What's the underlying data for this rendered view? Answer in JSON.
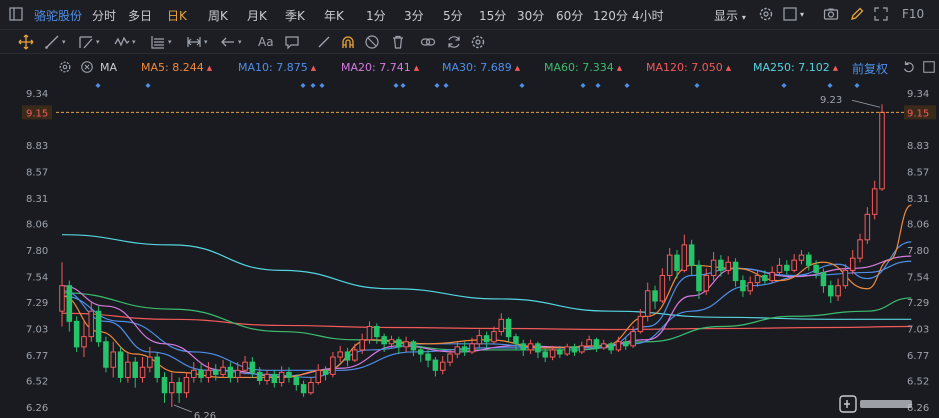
{
  "toolbar": {
    "stock_name": "骆驼股份",
    "periods": [
      "分时",
      "多日",
      "日K",
      "周K",
      "月K",
      "季K",
      "年K",
      "1分",
      "3分",
      "5分",
      "15分",
      "30分",
      "60分",
      "120分",
      "4小时"
    ],
    "active_period": "日K",
    "display_label": "显示",
    "f10_label": "F10"
  },
  "drawbar": {
    "text_tool_label": "Aa"
  },
  "ma_legend": {
    "type_label": "MA",
    "items": [
      {
        "label": "MA5: 8.244",
        "color": "#f08a3c"
      },
      {
        "label": "MA10: 7.875",
        "color": "#4f8fe8"
      },
      {
        "label": "MA20: 7.741",
        "color": "#d67be0"
      },
      {
        "label": "MA30: 7.689",
        "color": "#4f8fe8"
      },
      {
        "label": "MA60: 7.334",
        "color": "#3dbb6e"
      },
      {
        "label": "MA120: 7.050",
        "color": "#f25a5a"
      },
      {
        "label": "MA250: 7.102",
        "color": "#55d4e0"
      }
    ],
    "adjust_label": "前复权",
    "up_color": "#f25a5a"
  },
  "chart_data": {
    "type": "candlestick",
    "y_ticks": [
      "9.34",
      "9.15",
      "8.83",
      "8.57",
      "8.31",
      "8.06",
      "7.80",
      "7.54",
      "7.29",
      "7.03",
      "6.77",
      "6.52",
      "6.26"
    ],
    "ylim": [
      6.2,
      9.4
    ],
    "current_price": "9.15",
    "high_annotation": "9.23",
    "low_annotation": "6.26",
    "up_color": "#f25a5a",
    "down_color": "#27c36a",
    "candles": [
      [
        7.2,
        7.45,
        7.68,
        7.05
      ],
      [
        7.45,
        7.1,
        7.5,
        7.0
      ],
      [
        7.1,
        6.85,
        7.15,
        6.8
      ],
      [
        6.85,
        6.95,
        7.1,
        6.75
      ],
      [
        6.95,
        7.2,
        7.3,
        6.9
      ],
      [
        7.2,
        6.9,
        7.25,
        6.85
      ],
      [
        6.9,
        6.65,
        6.95,
        6.6
      ],
      [
        6.65,
        6.8,
        6.9,
        6.55
      ],
      [
        6.8,
        6.55,
        6.85,
        6.5
      ],
      [
        6.55,
        6.7,
        6.8,
        6.5
      ],
      [
        6.7,
        6.55,
        6.75,
        6.45
      ],
      [
        6.55,
        6.65,
        6.75,
        6.5
      ],
      [
        6.65,
        6.75,
        6.85,
        6.6
      ],
      [
        6.75,
        6.55,
        6.8,
        6.5
      ],
      [
        6.55,
        6.4,
        6.6,
        6.3
      ],
      [
        6.4,
        6.5,
        6.6,
        6.26
      ],
      [
        6.5,
        6.4,
        6.55,
        6.3
      ],
      [
        6.4,
        6.55,
        6.6,
        6.35
      ],
      [
        6.55,
        6.62,
        6.7,
        6.5
      ],
      [
        6.62,
        6.55,
        6.68,
        6.5
      ],
      [
        6.55,
        6.62,
        6.7,
        6.5
      ],
      [
        6.62,
        6.58,
        6.68,
        6.52
      ],
      [
        6.58,
        6.65,
        6.72,
        6.55
      ],
      [
        6.65,
        6.55,
        6.7,
        6.5
      ],
      [
        6.55,
        6.62,
        6.7,
        6.5
      ],
      [
        6.62,
        6.7,
        6.76,
        6.58
      ],
      [
        6.7,
        6.6,
        6.75,
        6.55
      ],
      [
        6.6,
        6.52,
        6.65,
        6.48
      ],
      [
        6.52,
        6.58,
        6.62,
        6.48
      ],
      [
        6.58,
        6.5,
        6.62,
        6.45
      ],
      [
        6.5,
        6.6,
        6.66,
        6.46
      ],
      [
        6.6,
        6.55,
        6.65,
        6.5
      ],
      [
        6.55,
        6.48,
        6.58,
        6.42
      ],
      [
        6.48,
        6.4,
        6.52,
        6.36
      ],
      [
        6.4,
        6.5,
        6.55,
        6.38
      ],
      [
        6.5,
        6.62,
        6.68,
        6.48
      ],
      [
        6.62,
        6.58,
        6.66,
        6.52
      ],
      [
        6.58,
        6.75,
        6.8,
        6.55
      ],
      [
        6.75,
        6.8,
        6.86,
        6.7
      ],
      [
        6.8,
        6.72,
        6.84,
        6.66
      ],
      [
        6.72,
        6.82,
        6.88,
        6.7
      ],
      [
        6.82,
        6.92,
        6.98,
        6.78
      ],
      [
        6.92,
        7.05,
        7.1,
        6.88
      ],
      [
        7.05,
        6.95,
        7.08,
        6.88
      ],
      [
        6.95,
        6.88,
        6.98,
        6.8
      ],
      [
        6.88,
        6.92,
        6.96,
        6.84
      ],
      [
        6.92,
        6.85,
        6.95,
        6.78
      ],
      [
        6.85,
        6.9,
        6.95,
        6.8
      ],
      [
        6.9,
        6.82,
        6.92,
        6.76
      ],
      [
        6.82,
        6.78,
        6.86,
        6.7
      ],
      [
        6.78,
        6.72,
        6.82,
        6.65
      ],
      [
        6.72,
        6.62,
        6.75,
        6.56
      ],
      [
        6.62,
        6.7,
        6.76,
        6.58
      ],
      [
        6.7,
        6.78,
        6.82,
        6.66
      ],
      [
        6.78,
        6.85,
        6.9,
        6.74
      ],
      [
        6.85,
        6.8,
        6.9,
        6.76
      ],
      [
        6.8,
        6.88,
        6.94,
        6.78
      ],
      [
        6.88,
        6.96,
        7.02,
        6.84
      ],
      [
        6.96,
        6.9,
        7.0,
        6.84
      ],
      [
        6.9,
        7.0,
        7.05,
        6.88
      ],
      [
        7.0,
        7.12,
        7.18,
        6.96
      ],
      [
        7.12,
        6.95,
        7.14,
        6.9
      ],
      [
        6.95,
        6.88,
        6.98,
        6.82
      ],
      [
        6.88,
        6.82,
        6.92,
        6.76
      ],
      [
        6.82,
        6.88,
        6.92,
        6.78
      ],
      [
        6.88,
        6.8,
        6.9,
        6.74
      ],
      [
        6.8,
        6.75,
        6.84,
        6.7
      ],
      [
        6.75,
        6.82,
        6.86,
        6.72
      ],
      [
        6.82,
        6.78,
        6.86,
        6.74
      ],
      [
        6.78,
        6.85,
        6.88,
        6.76
      ],
      [
        6.85,
        6.8,
        6.88,
        6.76
      ],
      [
        6.8,
        6.86,
        6.9,
        6.78
      ],
      [
        6.86,
        6.92,
        6.96,
        6.84
      ],
      [
        6.92,
        6.84,
        6.94,
        6.8
      ],
      [
        6.84,
        6.88,
        6.92,
        6.82
      ],
      [
        6.88,
        6.82,
        6.9,
        6.78
      ],
      [
        6.82,
        6.9,
        6.95,
        6.8
      ],
      [
        6.9,
        6.86,
        6.94,
        6.82
      ],
      [
        6.86,
        7.0,
        7.05,
        6.84
      ],
      [
        7.0,
        7.15,
        7.22,
        6.98
      ],
      [
        7.15,
        7.4,
        7.48,
        7.1
      ],
      [
        7.4,
        7.3,
        7.45,
        7.22
      ],
      [
        7.3,
        7.55,
        7.62,
        7.28
      ],
      [
        7.55,
        7.75,
        7.82,
        7.5
      ],
      [
        7.75,
        7.6,
        7.8,
        7.52
      ],
      [
        7.6,
        7.85,
        7.95,
        7.58
      ],
      [
        7.85,
        7.65,
        7.9,
        7.55
      ],
      [
        7.65,
        7.4,
        7.7,
        7.32
      ],
      [
        7.4,
        7.55,
        7.62,
        7.36
      ],
      [
        7.55,
        7.7,
        7.78,
        7.5
      ],
      [
        7.7,
        7.6,
        7.75,
        7.54
      ],
      [
        7.6,
        7.68,
        7.74,
        7.56
      ],
      [
        7.68,
        7.5,
        7.72,
        7.44
      ],
      [
        7.5,
        7.4,
        7.55,
        7.34
      ],
      [
        7.4,
        7.48,
        7.54,
        7.36
      ],
      [
        7.48,
        7.55,
        7.6,
        7.44
      ],
      [
        7.55,
        7.5,
        7.6,
        7.46
      ],
      [
        7.5,
        7.58,
        7.64,
        7.48
      ],
      [
        7.58,
        7.65,
        7.72,
        7.54
      ],
      [
        7.65,
        7.6,
        7.7,
        7.56
      ],
      [
        7.6,
        7.7,
        7.76,
        7.58
      ],
      [
        7.7,
        7.75,
        7.8,
        7.66
      ],
      [
        7.75,
        7.65,
        7.78,
        7.6
      ],
      [
        7.65,
        7.58,
        7.7,
        7.52
      ],
      [
        7.58,
        7.45,
        7.62,
        7.38
      ],
      [
        7.45,
        7.35,
        7.5,
        7.28
      ],
      [
        7.35,
        7.45,
        7.52,
        7.3
      ],
      [
        7.45,
        7.6,
        7.66,
        7.42
      ],
      [
        7.6,
        7.72,
        7.8,
        7.56
      ],
      [
        7.72,
        7.9,
        7.96,
        7.68
      ],
      [
        7.9,
        8.15,
        8.22,
        7.86
      ],
      [
        8.15,
        8.4,
        8.48,
        8.1
      ],
      [
        8.4,
        9.15,
        9.23,
        8.38
      ]
    ],
    "ma_lines": [
      {
        "name": "MA250",
        "color": "#55d4e0",
        "points": [
          [
            0,
            7.95
          ],
          [
            15,
            7.85
          ],
          [
            30,
            7.6
          ],
          [
            45,
            7.42
          ],
          [
            60,
            7.32
          ],
          [
            75,
            7.2
          ],
          [
            90,
            7.14
          ],
          [
            105,
            7.12
          ],
          [
            116,
            7.12
          ]
        ]
      },
      {
        "name": "MA120",
        "color": "#f25a5a",
        "points": [
          [
            0,
            7.18
          ],
          [
            15,
            7.12
          ],
          [
            30,
            7.06
          ],
          [
            45,
            7.04
          ],
          [
            60,
            7.03
          ],
          [
            75,
            7.02
          ],
          [
            90,
            7.03
          ],
          [
            105,
            7.04
          ],
          [
            116,
            7.05
          ]
        ]
      },
      {
        "name": "MA60",
        "color": "#3dbb6e",
        "points": [
          [
            0,
            7.38
          ],
          [
            15,
            7.22
          ],
          [
            30,
            7.0
          ],
          [
            40,
            6.92
          ],
          [
            55,
            6.82
          ],
          [
            70,
            6.82
          ],
          [
            80,
            6.9
          ],
          [
            90,
            7.05
          ],
          [
            100,
            7.15
          ],
          [
            110,
            7.2
          ],
          [
            116,
            7.33
          ]
        ]
      },
      {
        "name": "MA30",
        "color": "#4f8fe8",
        "points": [
          [
            0,
            7.35
          ],
          [
            8,
            7.1
          ],
          [
            18,
            6.8
          ],
          [
            28,
            6.62
          ],
          [
            38,
            6.62
          ],
          [
            48,
            6.8
          ],
          [
            58,
            6.84
          ],
          [
            68,
            6.84
          ],
          [
            78,
            6.88
          ],
          [
            86,
            7.2
          ],
          [
            94,
            7.45
          ],
          [
            102,
            7.55
          ],
          [
            110,
            7.58
          ],
          [
            116,
            7.69
          ]
        ]
      },
      {
        "name": "MA20",
        "color": "#d67be0",
        "points": [
          [
            0,
            7.45
          ],
          [
            6,
            7.25
          ],
          [
            14,
            6.88
          ],
          [
            22,
            6.62
          ],
          [
            30,
            6.56
          ],
          [
            38,
            6.64
          ],
          [
            46,
            6.86
          ],
          [
            54,
            6.8
          ],
          [
            62,
            6.86
          ],
          [
            72,
            6.84
          ],
          [
            80,
            6.92
          ],
          [
            86,
            7.35
          ],
          [
            92,
            7.62
          ],
          [
            100,
            7.54
          ],
          [
            108,
            7.62
          ],
          [
            116,
            7.74
          ]
        ]
      },
      {
        "name": "MA10",
        "color": "#4f8fe8",
        "points": [
          [
            0,
            7.4
          ],
          [
            6,
            7.1
          ],
          [
            12,
            6.8
          ],
          [
            20,
            6.62
          ],
          [
            28,
            6.58
          ],
          [
            34,
            6.55
          ],
          [
            42,
            6.82
          ],
          [
            50,
            6.88
          ],
          [
            58,
            6.88
          ],
          [
            66,
            6.84
          ],
          [
            74,
            6.84
          ],
          [
            80,
            7.05
          ],
          [
            86,
            7.55
          ],
          [
            92,
            7.62
          ],
          [
            100,
            7.55
          ],
          [
            106,
            7.66
          ],
          [
            110,
            7.52
          ],
          [
            116,
            7.88
          ]
        ]
      },
      {
        "name": "MA5",
        "color": "#f08a3c",
        "points": [
          [
            0,
            7.35
          ],
          [
            5,
            7.0
          ],
          [
            10,
            6.78
          ],
          [
            16,
            6.6
          ],
          [
            22,
            6.55
          ],
          [
            30,
            6.55
          ],
          [
            36,
            6.62
          ],
          [
            42,
            6.92
          ],
          [
            50,
            6.88
          ],
          [
            58,
            6.92
          ],
          [
            66,
            6.84
          ],
          [
            74,
            6.86
          ],
          [
            80,
            7.15
          ],
          [
            86,
            7.65
          ],
          [
            92,
            7.62
          ],
          [
            98,
            7.5
          ],
          [
            104,
            7.68
          ],
          [
            110,
            7.42
          ],
          [
            113,
            7.7
          ],
          [
            116,
            8.24
          ]
        ]
      }
    ],
    "marker_color": "#4f8fe8"
  }
}
